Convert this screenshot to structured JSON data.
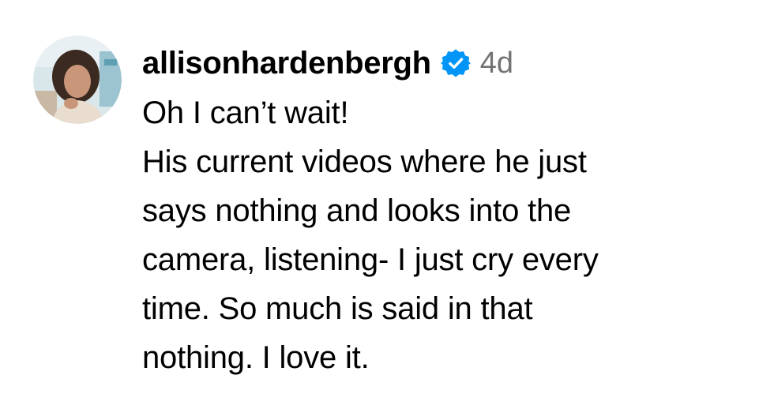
{
  "comment": {
    "username": "allisonhardenbergh",
    "verified": true,
    "verified_icon": "verified-badge-icon",
    "verified_color": "#0095f6",
    "timestamp": "4d",
    "text_lines": [
      "Oh I can’t wait!",
      "His current videos where he just",
      "says nothing and looks into the",
      "camera, listening- I just cry every",
      "time. So much is said in that",
      "nothing. I love it."
    ]
  }
}
